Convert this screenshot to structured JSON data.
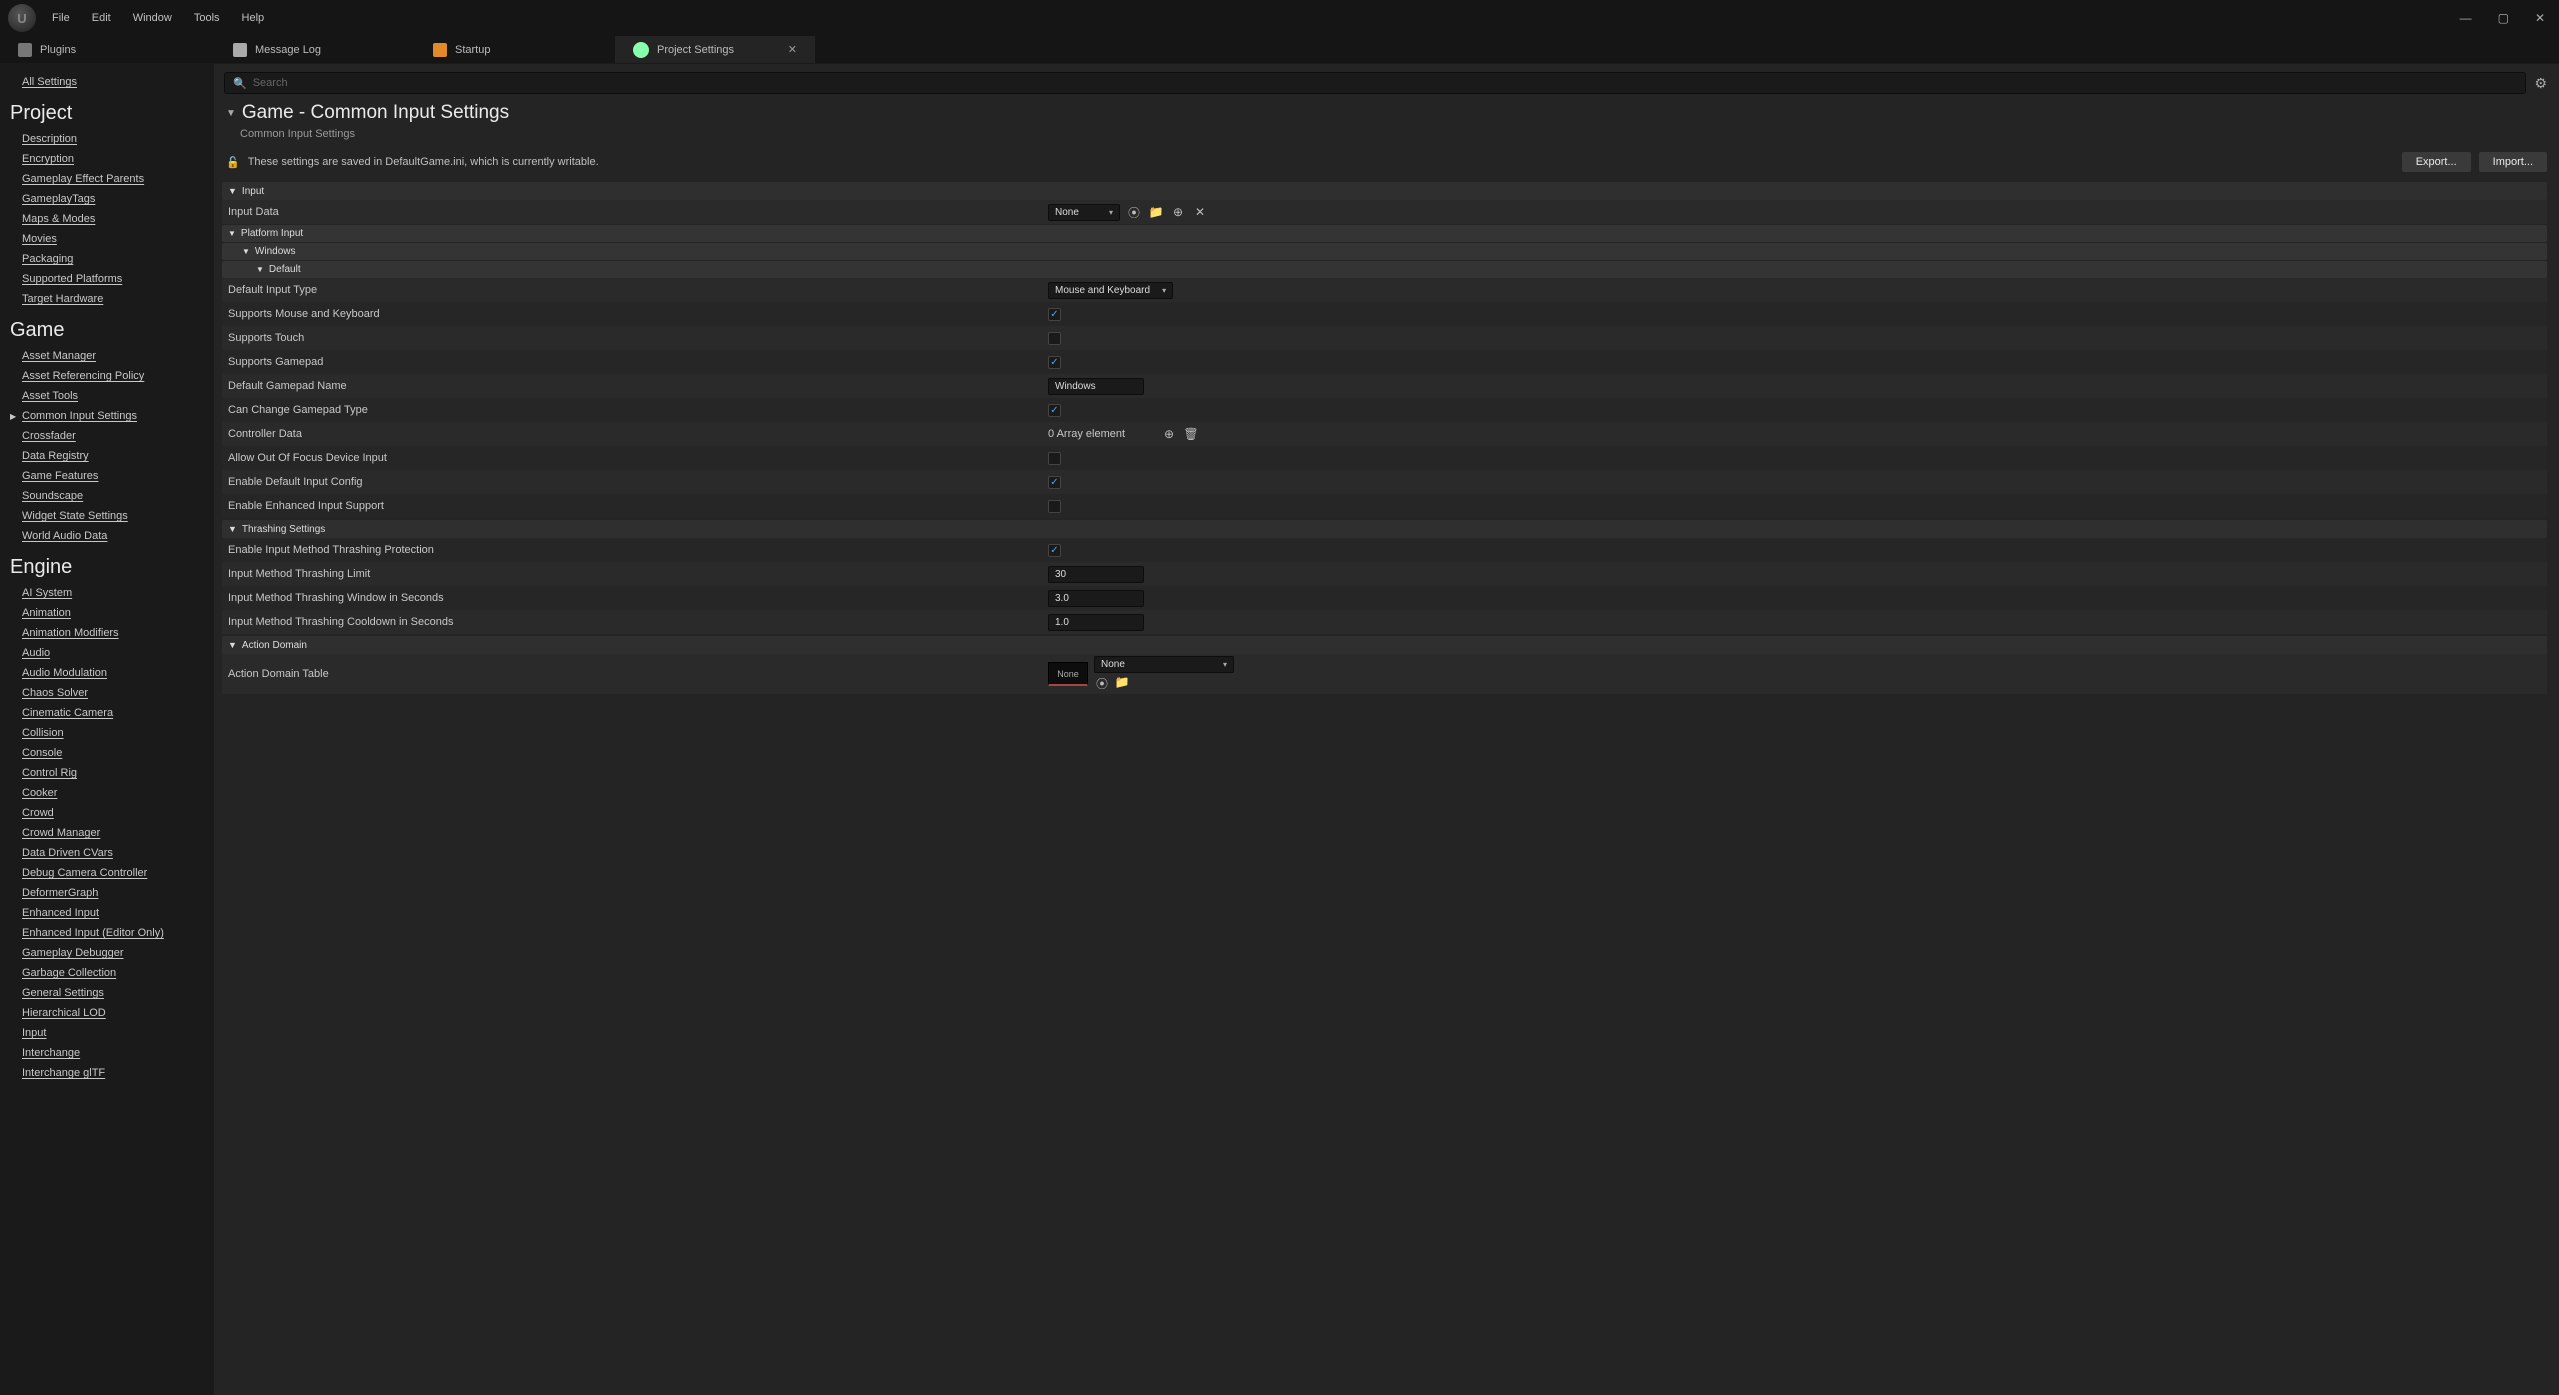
{
  "menu": {
    "file": "File",
    "edit": "Edit",
    "window": "Window",
    "tools": "Tools",
    "help": "Help"
  },
  "tabs": {
    "plugins": "Plugins",
    "msglog": "Message Log",
    "startup": "Startup",
    "project": "Project Settings"
  },
  "sidebar": {
    "all": "All Settings",
    "cat1": "Project",
    "project": [
      "Description",
      "Encryption",
      "Gameplay Effect Parents",
      "GameplayTags",
      "Maps & Modes",
      "Movies",
      "Packaging",
      "Supported Platforms",
      "Target Hardware"
    ],
    "cat2": "Game",
    "game": [
      "Asset Manager",
      "Asset Referencing Policy",
      "Asset Tools",
      "Common Input Settings",
      "Crossfader",
      "Data Registry",
      "Game Features",
      "Soundscape",
      "Widget State Settings",
      "World Audio Data"
    ],
    "cat3": "Engine",
    "engine": [
      "AI System",
      "Animation",
      "Animation Modifiers",
      "Audio",
      "Audio Modulation",
      "Chaos Solver",
      "Cinematic Camera",
      "Collision",
      "Console",
      "Control Rig",
      "Cooker",
      "Crowd",
      "Crowd Manager",
      "Data Driven CVars",
      "Debug Camera Controller",
      "DeformerGraph",
      "Enhanced Input",
      "Enhanced Input (Editor Only)",
      "Gameplay Debugger",
      "Garbage Collection",
      "General Settings",
      "Hierarchical LOD",
      "Input",
      "Interchange",
      "Interchange glTF"
    ]
  },
  "header": {
    "title": "Game - Common Input Settings",
    "sub": "Common Input Settings",
    "saved": "These settings are saved in DefaultGame.ini, which is currently writable.",
    "export": "Export...",
    "import": "Import..."
  },
  "search": {
    "placeholder": "Search"
  },
  "sections": {
    "input": "Input",
    "platform": "Platform Input",
    "windows": "Windows",
    "default": "Default",
    "thrash": "Thrashing Settings",
    "action": "Action Domain"
  },
  "labels": {
    "inputData": "Input Data",
    "defType": "Default Input Type",
    "supMK": "Supports Mouse and Keyboard",
    "supTouch": "Supports Touch",
    "supGP": "Supports Gamepad",
    "defGP": "Default Gamepad Name",
    "canChange": "Can Change Gamepad Type",
    "ctrlData": "Controller Data",
    "allowOOF": "Allow Out Of Focus Device Input",
    "enDefCfg": "Enable Default Input Config",
    "enEnh": "Enable Enhanced Input Support",
    "enProt": "Enable Input Method Thrashing Protection",
    "thrLimit": "Input Method Thrashing Limit",
    "thrWin": "Input Method Thrashing Window in Seconds",
    "thrCd": "Input Method Thrashing Cooldown in Seconds",
    "actTbl": "Action Domain Table"
  },
  "values": {
    "none": "None",
    "mk": "Mouse and Keyboard",
    "windows": "Windows",
    "arrayEmpty": "0 Array element",
    "thirty": "30",
    "three": "3.0",
    "one": "1.0"
  }
}
